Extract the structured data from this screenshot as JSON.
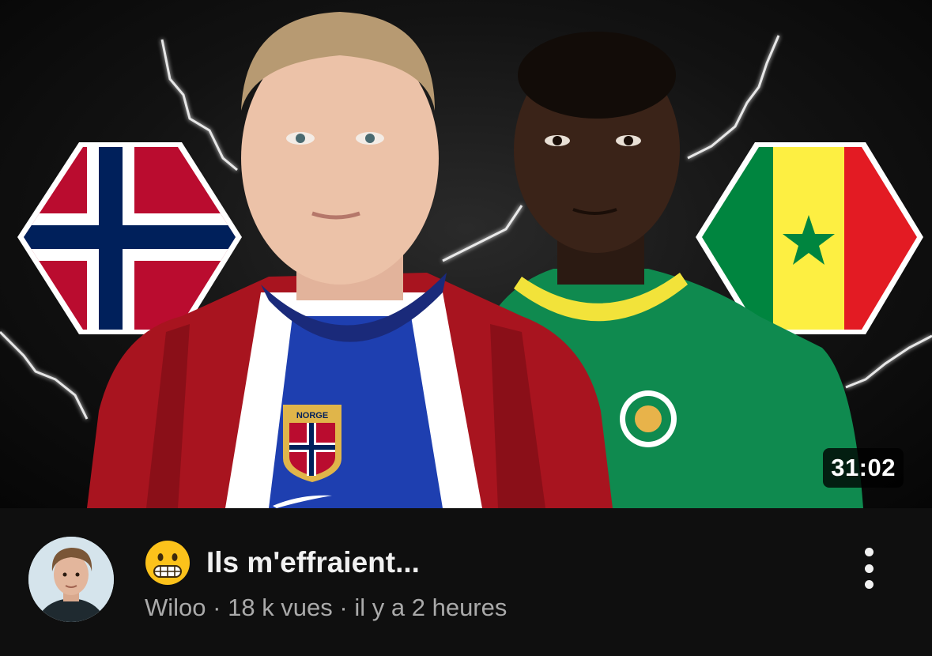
{
  "video": {
    "duration": "31:02",
    "title": "Ils m'effraient...",
    "title_emoji": "grimacing-face",
    "channel": "Wiloo",
    "views": "18 k vues",
    "separator": "·",
    "published": "il y a 2 heures"
  },
  "thumbnail": {
    "left_flag": "norway-flag-icon",
    "right_flag": "senegal-flag-icon",
    "badge_text": "NORGE"
  },
  "menu": {
    "icon": "more-vert-icon"
  },
  "colors": {
    "background": "#0f0f0f",
    "title": "#f1f1f1",
    "secondary": "#aaaaaa",
    "norway_red": "#ba0c2f",
    "norway_blue": "#00205b",
    "senegal_green": "#00853f",
    "senegal_yellow": "#fdef42",
    "senegal_red": "#e31b23"
  }
}
